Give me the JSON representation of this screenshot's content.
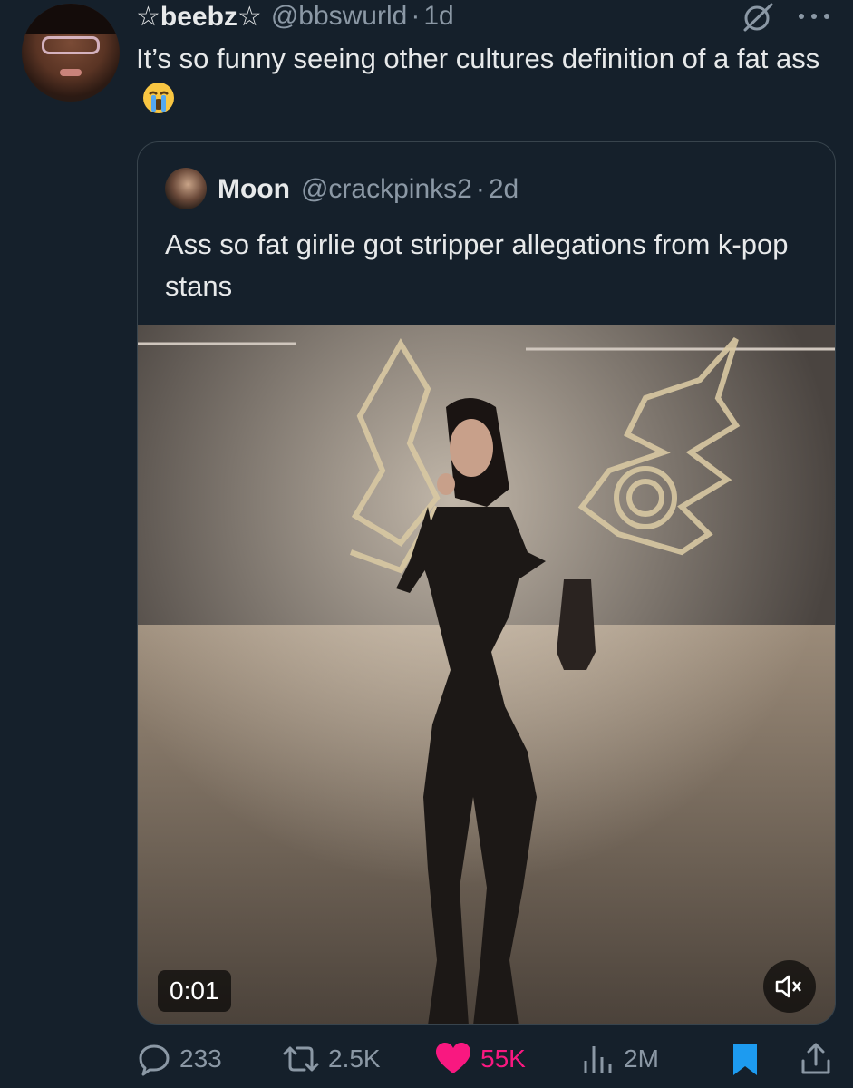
{
  "tweet": {
    "display_name": "☆beebz☆",
    "handle": "@bbswurld",
    "separator": "·",
    "time": "1d",
    "text": "It’s so funny seeing other cultures definition of a fat ass",
    "emoji": "loudly-crying-face"
  },
  "quote": {
    "display_name": "Moon",
    "handle": "@crackpinks2",
    "separator": "·",
    "time": "2d",
    "text": "Ass so fat girlie got stripper allegations from k-pop stans",
    "video": {
      "timestamp": "0:01",
      "muted": true
    }
  },
  "actions": {
    "replies": "233",
    "retweets": "2.5K",
    "likes": "55K",
    "views": "2M",
    "liked": true,
    "bookmarked": true
  },
  "colors": {
    "background": "#15202b",
    "text": "#e7e9ea",
    "secondary": "#8b98a5",
    "border": "#38444d",
    "like": "#f91880",
    "bookmark": "#1d9bf0"
  },
  "icons": [
    "more-icon",
    "grok-icon",
    "reply-icon",
    "retweet-icon",
    "heart-icon",
    "views-icon",
    "bookmark-icon",
    "share-icon",
    "mute-icon"
  ]
}
